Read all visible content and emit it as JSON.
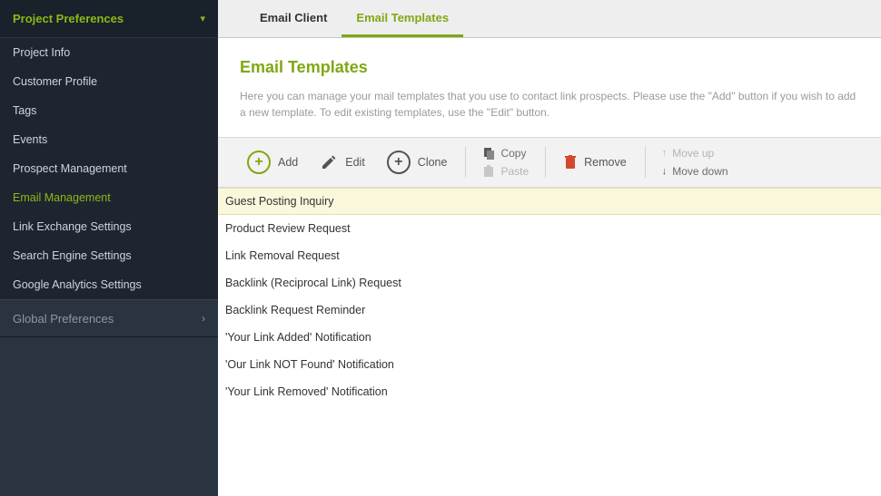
{
  "sidebar": {
    "header": "Project Preferences",
    "items": [
      {
        "label": "Project Info",
        "active": false
      },
      {
        "label": "Customer Profile",
        "active": false
      },
      {
        "label": "Tags",
        "active": false
      },
      {
        "label": "Events",
        "active": false
      },
      {
        "label": "Prospect Management",
        "active": false
      },
      {
        "label": "Email Management",
        "active": true
      },
      {
        "label": "Link Exchange Settings",
        "active": false
      },
      {
        "label": "Search Engine Settings",
        "active": false
      },
      {
        "label": "Google Analytics Settings",
        "active": false
      }
    ],
    "global": "Global Preferences"
  },
  "tabs": [
    {
      "label": "Email Client",
      "active": false
    },
    {
      "label": "Email Templates",
      "active": true
    }
  ],
  "page": {
    "title": "Email Templates",
    "description": "Here you can manage your mail templates that you use to contact link prospects. Please use the \"Add\" button if you wish to add a new template. To edit existing templates, use the \"Edit\" button."
  },
  "toolbar": {
    "add": "Add",
    "edit": "Edit",
    "clone": "Clone",
    "copy": "Copy",
    "paste": "Paste",
    "remove": "Remove",
    "moveup": "Move up",
    "movedown": "Move down"
  },
  "templates": [
    {
      "name": "Guest Posting Inquiry",
      "selected": true
    },
    {
      "name": "Product Review Request",
      "selected": false
    },
    {
      "name": "Link Removal Request",
      "selected": false
    },
    {
      "name": "Backlink (Reciprocal Link) Request",
      "selected": false
    },
    {
      "name": "Backlink Request Reminder",
      "selected": false
    },
    {
      "name": "'Your Link Added' Notification",
      "selected": false
    },
    {
      "name": "'Our Link NOT Found' Notification",
      "selected": false
    },
    {
      "name": "'Your Link Removed' Notification",
      "selected": false
    }
  ]
}
